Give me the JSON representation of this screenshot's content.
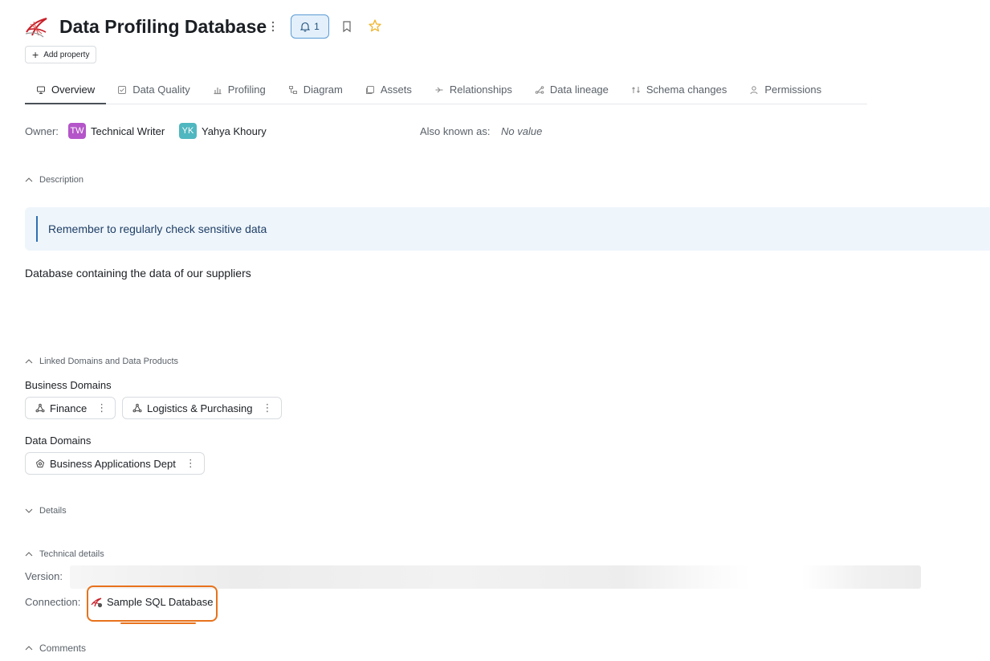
{
  "header": {
    "title": "Data Profiling Database",
    "notification_count": "1",
    "add_property_label": "Add property"
  },
  "tabs": [
    {
      "label": "Overview",
      "icon": "overview-icon",
      "active": true
    },
    {
      "label": "Data Quality",
      "icon": "data-quality-icon"
    },
    {
      "label": "Profiling",
      "icon": "profiling-icon"
    },
    {
      "label": "Diagram",
      "icon": "diagram-icon"
    },
    {
      "label": "Assets",
      "icon": "assets-icon"
    },
    {
      "label": "Relationships",
      "icon": "relationships-icon"
    },
    {
      "label": "Data lineage",
      "icon": "lineage-icon"
    },
    {
      "label": "Schema changes",
      "icon": "schema-changes-icon"
    },
    {
      "label": "Permissions",
      "icon": "permissions-icon"
    }
  ],
  "owners": {
    "label": "Owner:",
    "items": [
      {
        "initials": "TW",
        "name": "Technical Writer",
        "color": "#b455c9"
      },
      {
        "initials": "YK",
        "name": "Yahya Khoury",
        "color": "#4fb7bf"
      }
    ]
  },
  "also_known_as": {
    "label": "Also known as:",
    "value": "No value"
  },
  "description": {
    "header": "Description",
    "callout": "Remember to regularly check sensitive data",
    "text": "Database containing the data of our suppliers"
  },
  "linked": {
    "header": "Linked Domains and Data Products",
    "business_domains_label": "Business Domains",
    "business_domains": [
      "Finance",
      "Logistics & Purchasing"
    ],
    "data_domains_label": "Data Domains",
    "data_domains": [
      "Business Applications Dept"
    ]
  },
  "details": {
    "header": "Details"
  },
  "technical": {
    "header": "Technical details",
    "version_label": "Version:",
    "connection_label": "Connection:",
    "connection_value": "Sample SQL Database"
  },
  "comments": {
    "header": "Comments"
  },
  "colors": {
    "accent": "#2f6fb3",
    "highlight": "#e8721c",
    "star": "#f0b429"
  }
}
